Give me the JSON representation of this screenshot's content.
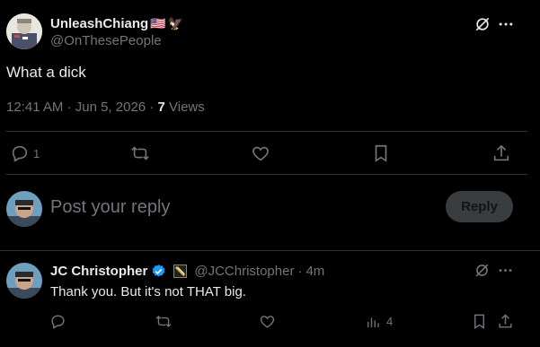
{
  "tweet": {
    "author_name": "UnleashChiang",
    "author_handle": "@OnThesePeople",
    "text": "What a dick",
    "time": "12:41 AM",
    "date": "Jun 5, 2026",
    "views_count": "7",
    "views_label": "Views",
    "reply_count": "1",
    "flag_emoji": "🇺🇸",
    "eagle_emoji": "🦅"
  },
  "composer": {
    "placeholder": "Post your reply",
    "reply_button": "Reply"
  },
  "reply": {
    "author_name": "JC Christopher",
    "author_handle": "@JCChristopher",
    "time": "4m",
    "text": "Thank you. But it's not THAT big.",
    "views_count": "4"
  },
  "colors": {
    "background": "#000000",
    "text": "#e7e9ea",
    "muted": "#71767b",
    "divider": "#2f3336",
    "verified": "#1d9bf0",
    "reply_button_bg": "#3a3d40"
  }
}
